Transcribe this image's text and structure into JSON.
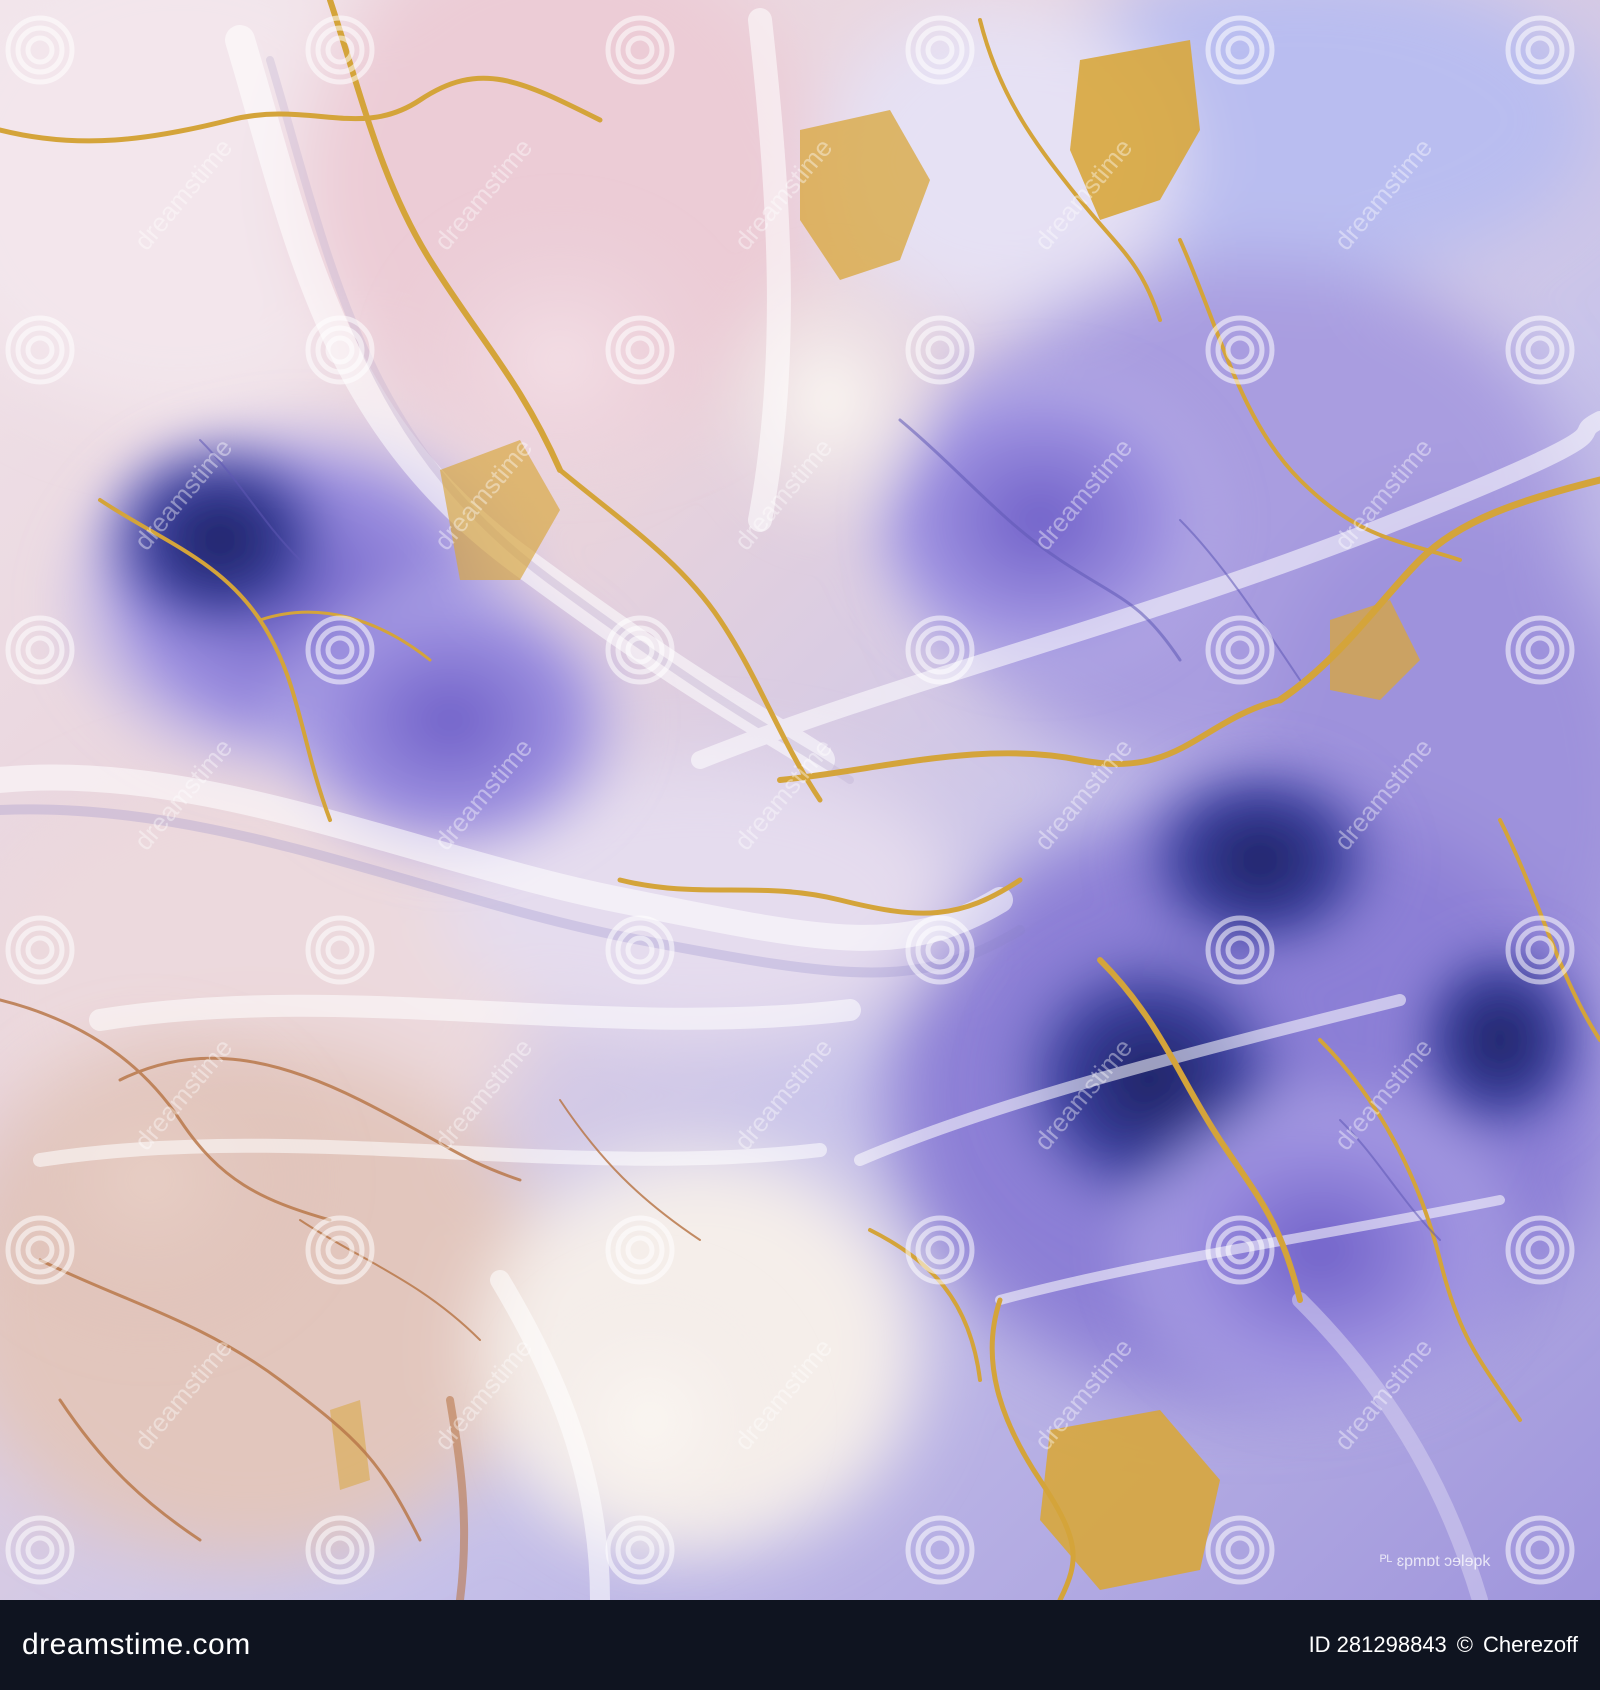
{
  "image": {
    "subject": "marble-fabric-artwork",
    "palette": {
      "lavender": "#a99de0",
      "violet": "#7f6fd0",
      "indigo": "#3c3f9a",
      "navy": "#1f2466",
      "blush": "#ecd6de",
      "cream": "#f3ece8",
      "peach": "#e2c6bd",
      "gold": "#d8a73d"
    }
  },
  "watermark": {
    "icon": "spiral-logo-icon",
    "text": "dreamstime"
  },
  "footer": {
    "brand": "dreamstime.com",
    "image_id": "ID 281298843",
    "copyright_symbol": "©",
    "author": "Cherezoff",
    "background": "#0f1420",
    "text_color": "#ffffff"
  },
  "caption_fragment": "ᴾᴸ ɛpmɒt ɔɘlɘpk"
}
